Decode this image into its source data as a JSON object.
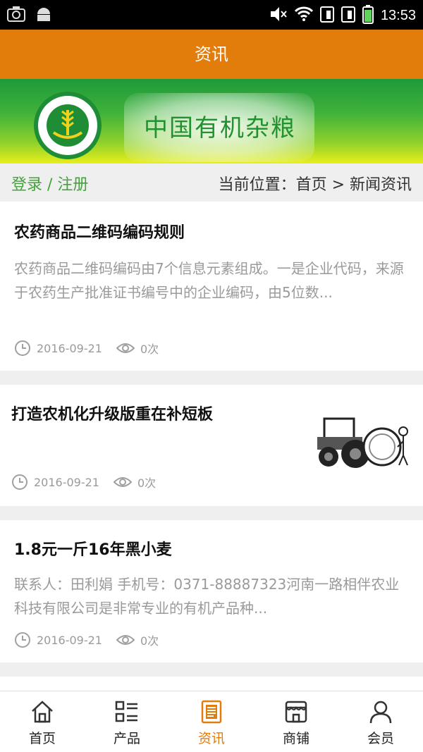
{
  "status_bar": {
    "time": "13:53"
  },
  "app_bar": {
    "title": "资讯"
  },
  "banner": {
    "title": "中国有机杂粮"
  },
  "breadcrumb": {
    "login": "登录 / 注册",
    "location": "当前位置：首页 > 新闻资讯"
  },
  "articles": [
    {
      "title": "农药商品二维码编码规则",
      "summary": "农药商品二维码编码由7个信息元素组成。一是企业代码，来源于农药生产批准证书编号中的企业编码，由5位数...",
      "date": "2016-09-21",
      "views": "0次"
    },
    {
      "title": "打造农机化升级版重在补短板",
      "summary": "",
      "date": "2016-09-21",
      "views": "0次"
    },
    {
      "title": "1.8元一斤16年黑小麦",
      "summary": "联系人：田利娟 手机号：0371-88887323河南一路相伴农业科技有限公司是非常专业的有机产品种...",
      "date": "2016-09-21",
      "views": "0次"
    }
  ],
  "bottom_nav": [
    {
      "label": "首页",
      "icon": "home-icon"
    },
    {
      "label": "产品",
      "icon": "grid-list-icon"
    },
    {
      "label": "资讯",
      "icon": "document-icon",
      "active": true
    },
    {
      "label": "商铺",
      "icon": "store-icon"
    },
    {
      "label": "会员",
      "icon": "user-icon"
    }
  ],
  "colors": {
    "accent": "#e27d0c",
    "green": "#44a23a"
  }
}
